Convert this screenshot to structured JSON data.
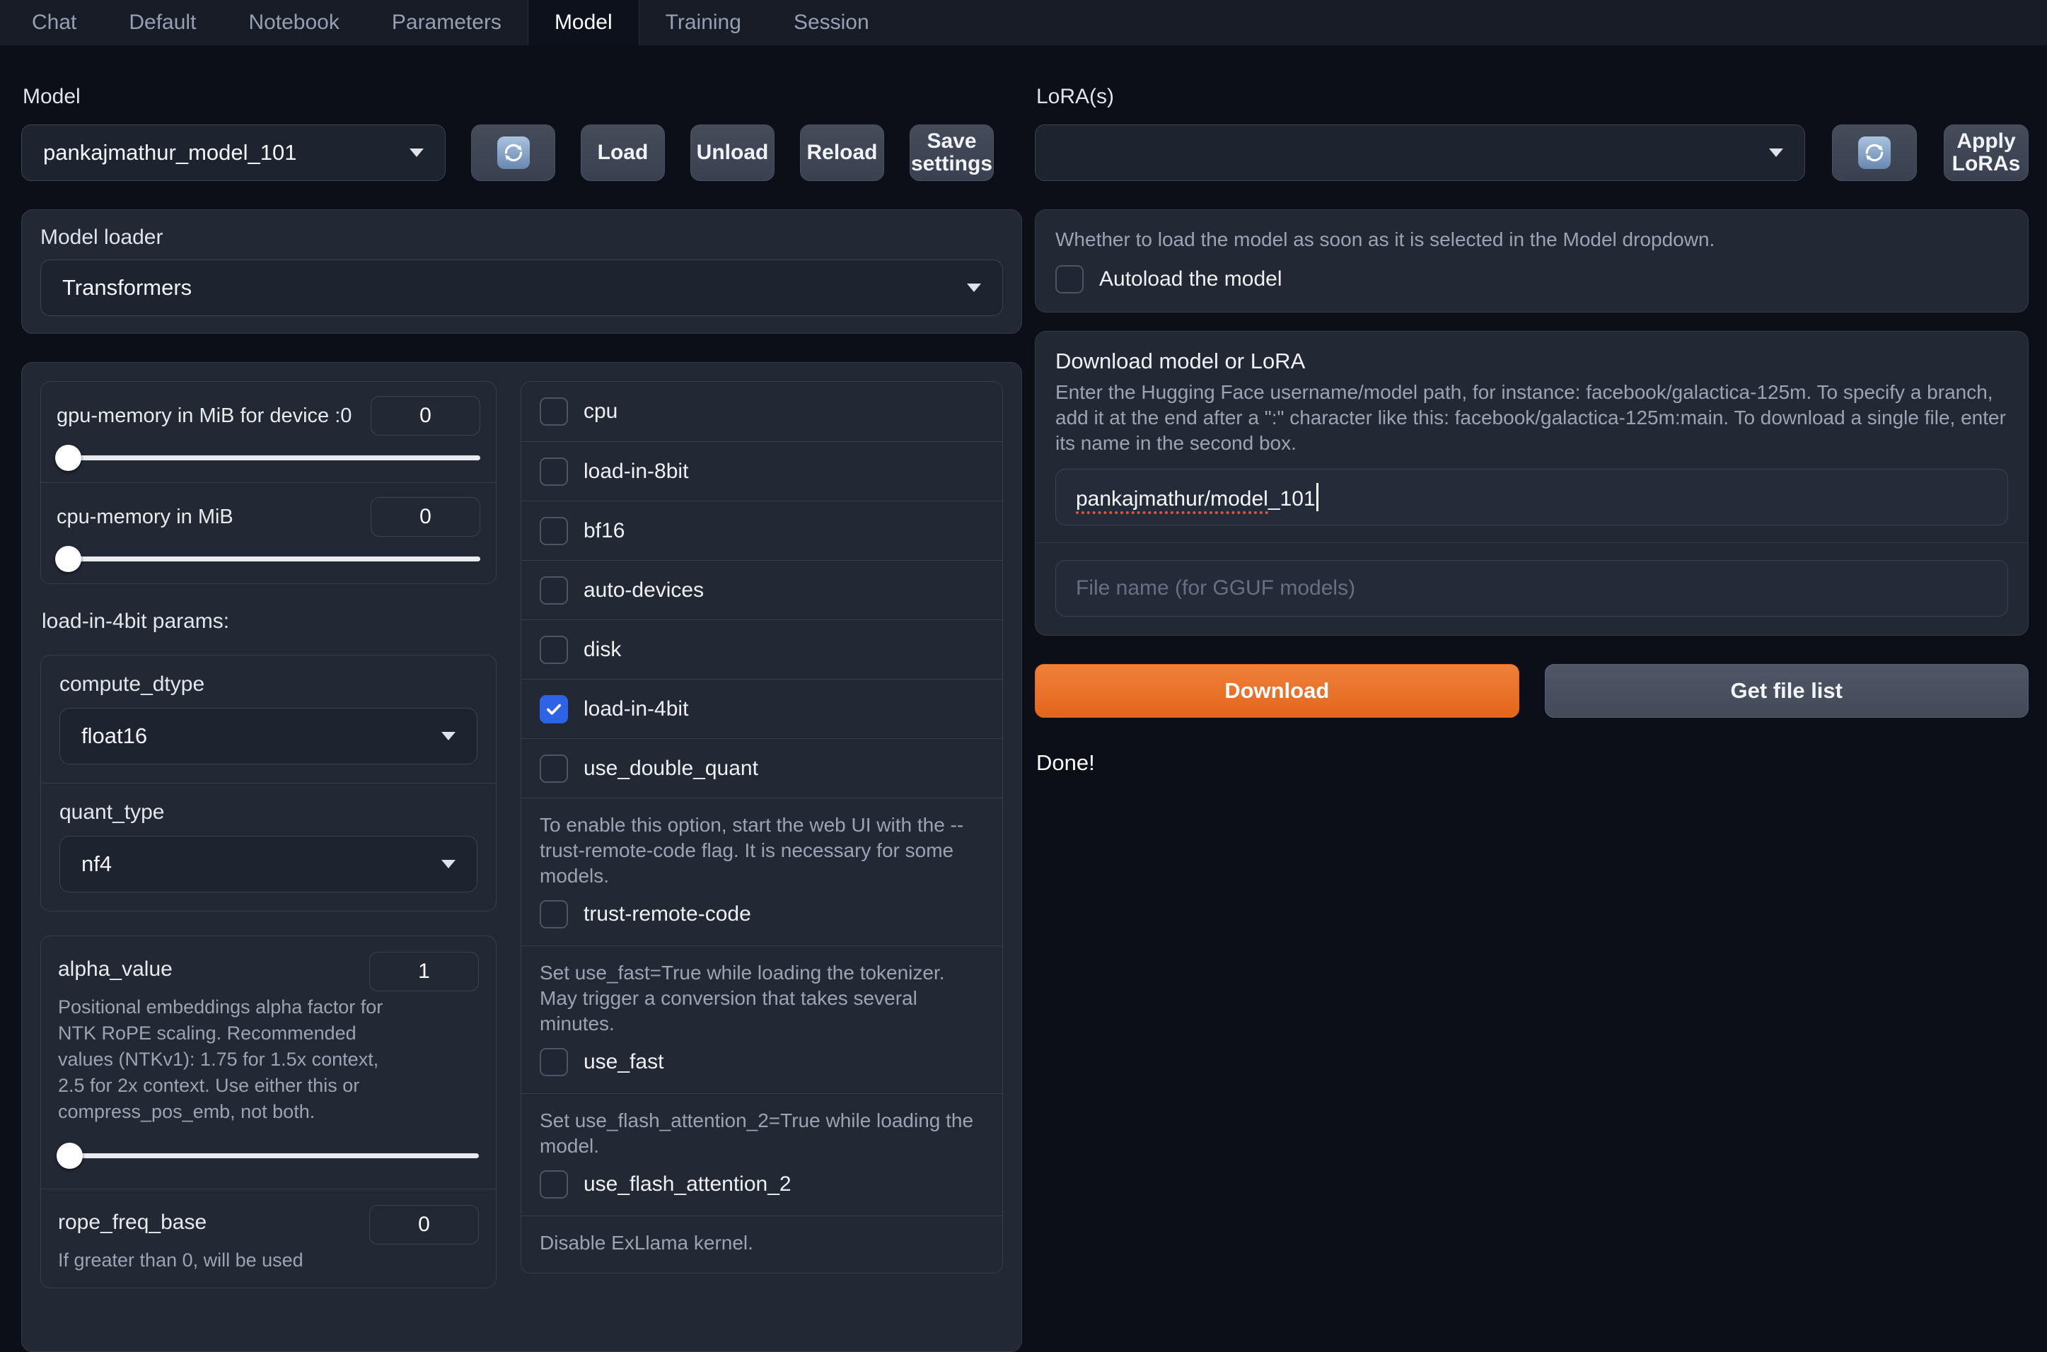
{
  "tabs": {
    "items": [
      {
        "label": "Chat"
      },
      {
        "label": "Default"
      },
      {
        "label": "Notebook"
      },
      {
        "label": "Parameters"
      },
      {
        "label": "Model"
      },
      {
        "label": "Training"
      },
      {
        "label": "Session"
      }
    ],
    "active": "Model"
  },
  "model_section": {
    "label": "Model",
    "selected_model": "pankajmathur_model_101",
    "load_button": "Load",
    "unload_button": "Unload",
    "reload_button": "Reload",
    "save_settings_button": "Save settings"
  },
  "lora_section": {
    "label": "LoRA(s)",
    "selected": "",
    "apply_button": "Apply LoRAs"
  },
  "model_loader": {
    "label": "Model loader",
    "value": "Transformers"
  },
  "left_params": {
    "gpu_memory": {
      "label": "gpu-memory in MiB for device :0",
      "value": "0",
      "slider_position": 0
    },
    "cpu_memory": {
      "label": "cpu-memory in MiB",
      "value": "0",
      "slider_position": 0
    },
    "load_in_4bit_params_label": "load-in-4bit params:",
    "compute_dtype": {
      "label": "compute_dtype",
      "value": "float16"
    },
    "quant_type": {
      "label": "quant_type",
      "value": "nf4"
    },
    "alpha_value": {
      "label": "alpha_value",
      "value": "1",
      "info": "Positional embeddings alpha factor for NTK RoPE scaling. Recommended values (NTKv1): 1.75 for 1.5x context, 2.5 for 2x context. Use either this or compress_pos_emb, not both.",
      "slider_position": 0
    },
    "rope_freq_base": {
      "label": "rope_freq_base",
      "value": "0",
      "info": "If greater than 0, will be used"
    }
  },
  "checkboxes": [
    {
      "label": "cpu",
      "checked": false
    },
    {
      "label": "load-in-8bit",
      "checked": false
    },
    {
      "label": "bf16",
      "checked": false
    },
    {
      "label": "auto-devices",
      "checked": false
    },
    {
      "label": "disk",
      "checked": false
    },
    {
      "label": "load-in-4bit",
      "checked": true
    },
    {
      "label": "use_double_quant",
      "checked": false
    }
  ],
  "info_checkboxes": [
    {
      "info": "To enable this option, start the web UI with the --trust-remote-code flag. It is necessary for some models.",
      "label": "trust-remote-code",
      "checked": false
    },
    {
      "info": "Set use_fast=True while loading the tokenizer. May trigger a conversion that takes several minutes.",
      "label": "use_fast",
      "checked": false
    },
    {
      "info": "Set use_flash_attention_2=True while loading the model.",
      "label": "use_flash_attention_2",
      "checked": false
    }
  ],
  "exllama_note": "Disable ExLlama kernel.",
  "autoload": {
    "info": "Whether to load the model as soon as it is selected in the Model dropdown.",
    "label": "Autoload the model",
    "checked": false
  },
  "download_section": {
    "title": "Download model or LoRA",
    "info": "Enter the Hugging Face username/model path, for instance: facebook/galactica-125m. To specify a branch, add it at the end after a \":\" character like this: facebook/galactica-125m:main. To download a single file, enter its name in the second box.",
    "model_input_misspelled_part": "pankajmathur/model",
    "model_input_rest": "_101",
    "file_input_placeholder": "File name (for GGUF models)",
    "download_button": "Download",
    "get_file_list_button": "Get file list",
    "status": "Done!"
  },
  "colors": {
    "page_background": "#0c0f18",
    "panel_background": "#222834",
    "input_background": "#1d2430",
    "border": "#3b4251",
    "accent_checkbox_blue": "#2e63e7",
    "accent_download_orange": "#e9731f",
    "info_text": "#9ba4b4"
  }
}
